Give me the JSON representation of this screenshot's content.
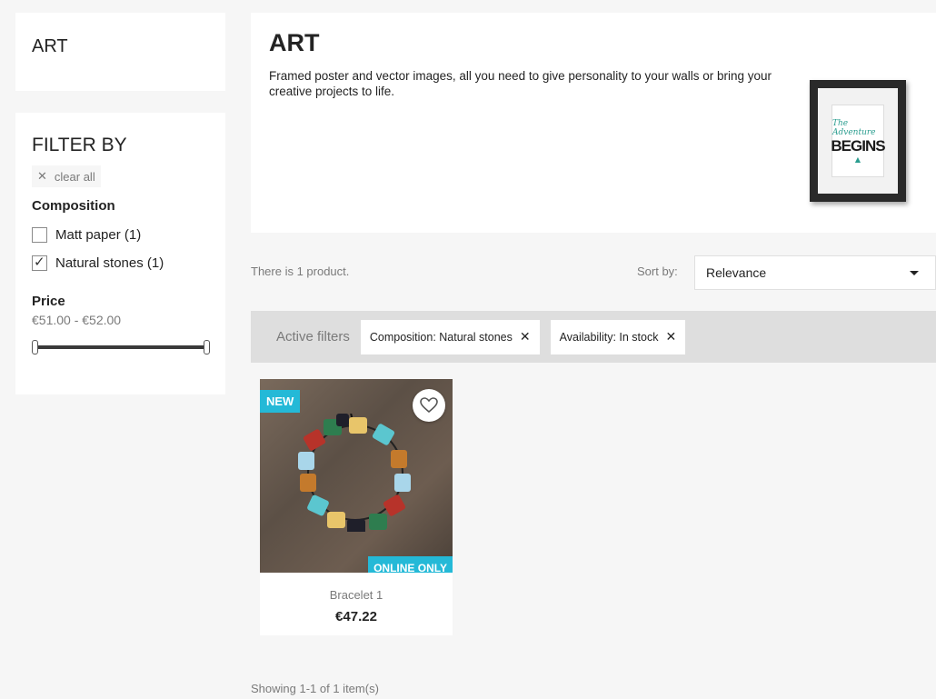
{
  "sidebar": {
    "category_title": "ART",
    "filter_title": "FILTER BY",
    "clear_all": "clear all",
    "facets": [
      {
        "title": "Composition",
        "options": [
          {
            "label": "Matt paper (1)",
            "checked": false
          },
          {
            "label": "Natural stones (1)",
            "checked": true
          }
        ]
      }
    ],
    "price": {
      "title": "Price",
      "range": "€51.00 - €52.00"
    }
  },
  "header": {
    "title": "ART",
    "description": "Framed poster and vector images, all you need to give personality to your walls or bring your creative projects to life.",
    "poster_text": {
      "line1": "The Adventure",
      "line2": "BEGINS"
    }
  },
  "toolbar": {
    "count": "There is 1 product.",
    "sort_label": "Sort by:",
    "sort_value": "Relevance"
  },
  "active_filters": {
    "label": "Active filters",
    "chips": [
      "Composition: Natural stones",
      "Availability: In stock"
    ]
  },
  "products": [
    {
      "badge_new": "NEW",
      "badge_online": "ONLINE ONLY",
      "name": "Bracelet 1",
      "price": "€47.22"
    }
  ],
  "footer": {
    "showing": "Showing 1-1 of 1 item(s)"
  },
  "colors": {
    "accent": "#24b9d7",
    "background": "#f6f6f6"
  }
}
